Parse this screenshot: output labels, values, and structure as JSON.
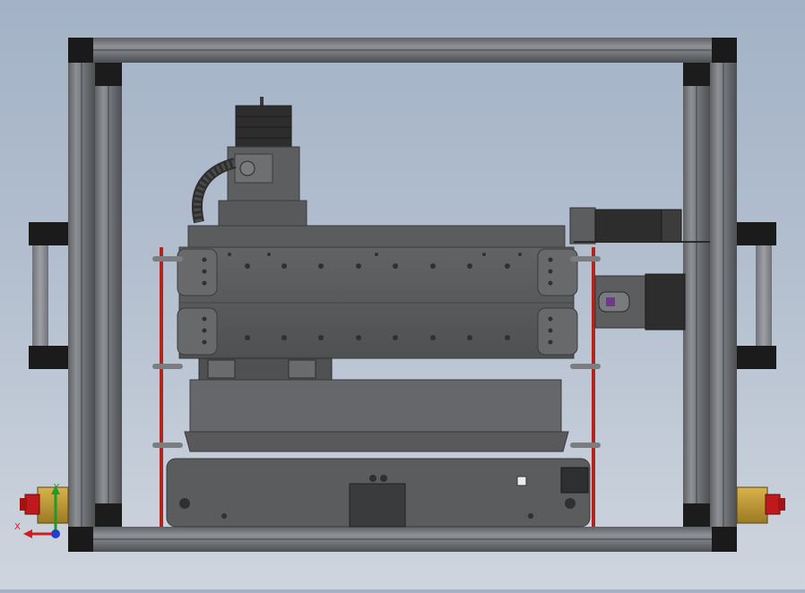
{
  "view": {
    "background_top": "#a3b2c6",
    "background_bottom": "#cfd5de",
    "frame_color": "#6f7276",
    "machine_color": "#5a5b5d",
    "rod_color": "#b2251f",
    "estop_color": "#c8a13a",
    "estop_button_color": "#c0191d"
  },
  "triad": {
    "x_label": "X",
    "y_label": "Y",
    "x_color": "#cc1f1f",
    "y_color": "#1f9a2b",
    "z_color": "#1f3fcc"
  }
}
